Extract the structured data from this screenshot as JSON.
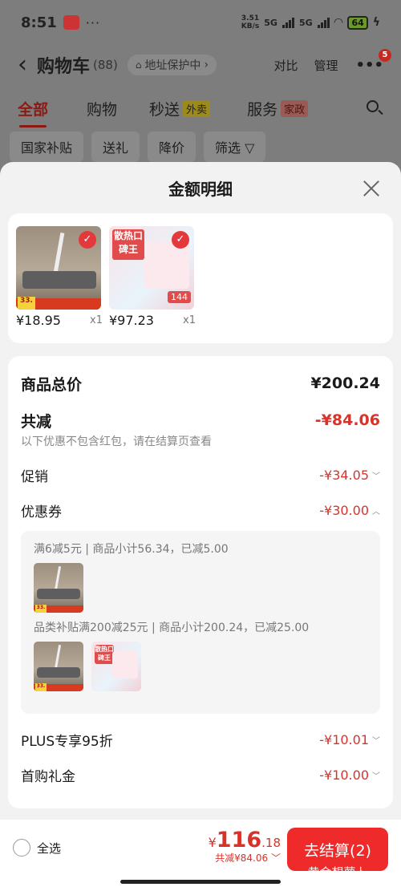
{
  "status_bar": {
    "time": "8:51",
    "dots": "···",
    "net_speed_top": "3.51",
    "net_speed_bottom": "KB/s",
    "sig1": "5G",
    "sig2": "5G",
    "battery": "64"
  },
  "header": {
    "title": "购物车",
    "count": "(88)",
    "address": "地址保护中",
    "address_chevron": "›",
    "compare": "对比",
    "manage": "管理",
    "more": "•••",
    "badge": "5"
  },
  "tabs": {
    "all": "全部",
    "shopping": "购物",
    "flash": "秒送",
    "flash_badge": "外卖",
    "service": "服务",
    "service_badge": "家政"
  },
  "filters": [
    "国家补贴",
    "送礼",
    "降价",
    "筛选 ▽"
  ],
  "sheet": {
    "title": "金额明细",
    "products": [
      {
        "price": "¥18.95",
        "qty": "x1",
        "icon": "mop-product"
      },
      {
        "price": "¥97.23",
        "qty": "x1",
        "icon": "pad-product"
      }
    ],
    "product_labels": {
      "mop_promo": "33.",
      "pad_title": "散热口碑王",
      "pad_price": "144"
    },
    "total_label": "商品总价",
    "total_value": "¥200.24",
    "discount_label": "共减",
    "discount_value": "-¥84.06",
    "discount_note": "以下优惠不包含红包，请在结算页查看",
    "promo_label": "促销",
    "promo_value": "-¥34.05",
    "coupon_label": "优惠券",
    "coupon_value": "-¥30.00",
    "coupon_details": [
      "满6减5元 | 商品小计56.34，已减5.00",
      "品类补贴满200减25元 | 商品小计200.24，已减25.00"
    ],
    "plus_label": "PLUS专享95折",
    "plus_value": "-¥10.01",
    "first_label": "首购礼金",
    "first_value": "-¥10.00"
  },
  "bottom": {
    "select_all": "全选",
    "currency": "¥",
    "total_int": "116",
    "total_dec": ".18",
    "discount_line": "共减¥84.06",
    "checkout": "去结算(2)",
    "checkout_sub": "黄金想萝卜"
  },
  "colors": {
    "accent_red": "#d8332b",
    "checkout_red": "#ef2a2a"
  }
}
